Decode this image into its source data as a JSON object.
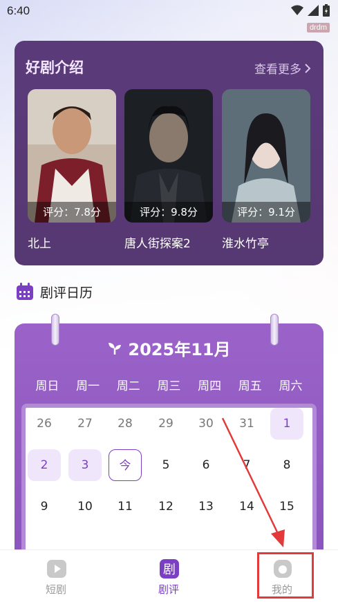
{
  "status_bar": {
    "time": "6:40",
    "tag": "drdm"
  },
  "drama_section": {
    "title": "好剧介绍",
    "more_label": "查看更多",
    "items": [
      {
        "name": "北上",
        "score": "评分：7.8分"
      },
      {
        "name": "唐人街探案2",
        "score": "评分：9.8分"
      },
      {
        "name": "淮水竹亭",
        "score": "评分：9.1分"
      }
    ]
  },
  "calendar_section": {
    "heading": "剧评日历",
    "month": "2025年11月",
    "weekdays": [
      "周日",
      "周一",
      "周二",
      "周三",
      "周四",
      "周五",
      "周六"
    ],
    "days_row1": [
      "26",
      "27",
      "28",
      "29",
      "30",
      "31",
      "1"
    ],
    "days_row2": [
      "2",
      "3",
      "今",
      "5",
      "6",
      "7",
      "8"
    ],
    "days_row3": [
      "9",
      "10",
      "11",
      "12",
      "13",
      "14",
      "15"
    ]
  },
  "bottom_nav": {
    "items": [
      {
        "label": "短剧"
      },
      {
        "label": "剧评"
      },
      {
        "label": "我的"
      }
    ],
    "active_label": "剧评"
  },
  "colors": {
    "accent": "#7b3fc4",
    "card_bg": "#5b3a7a",
    "annotation_red": "#e23a3a"
  }
}
